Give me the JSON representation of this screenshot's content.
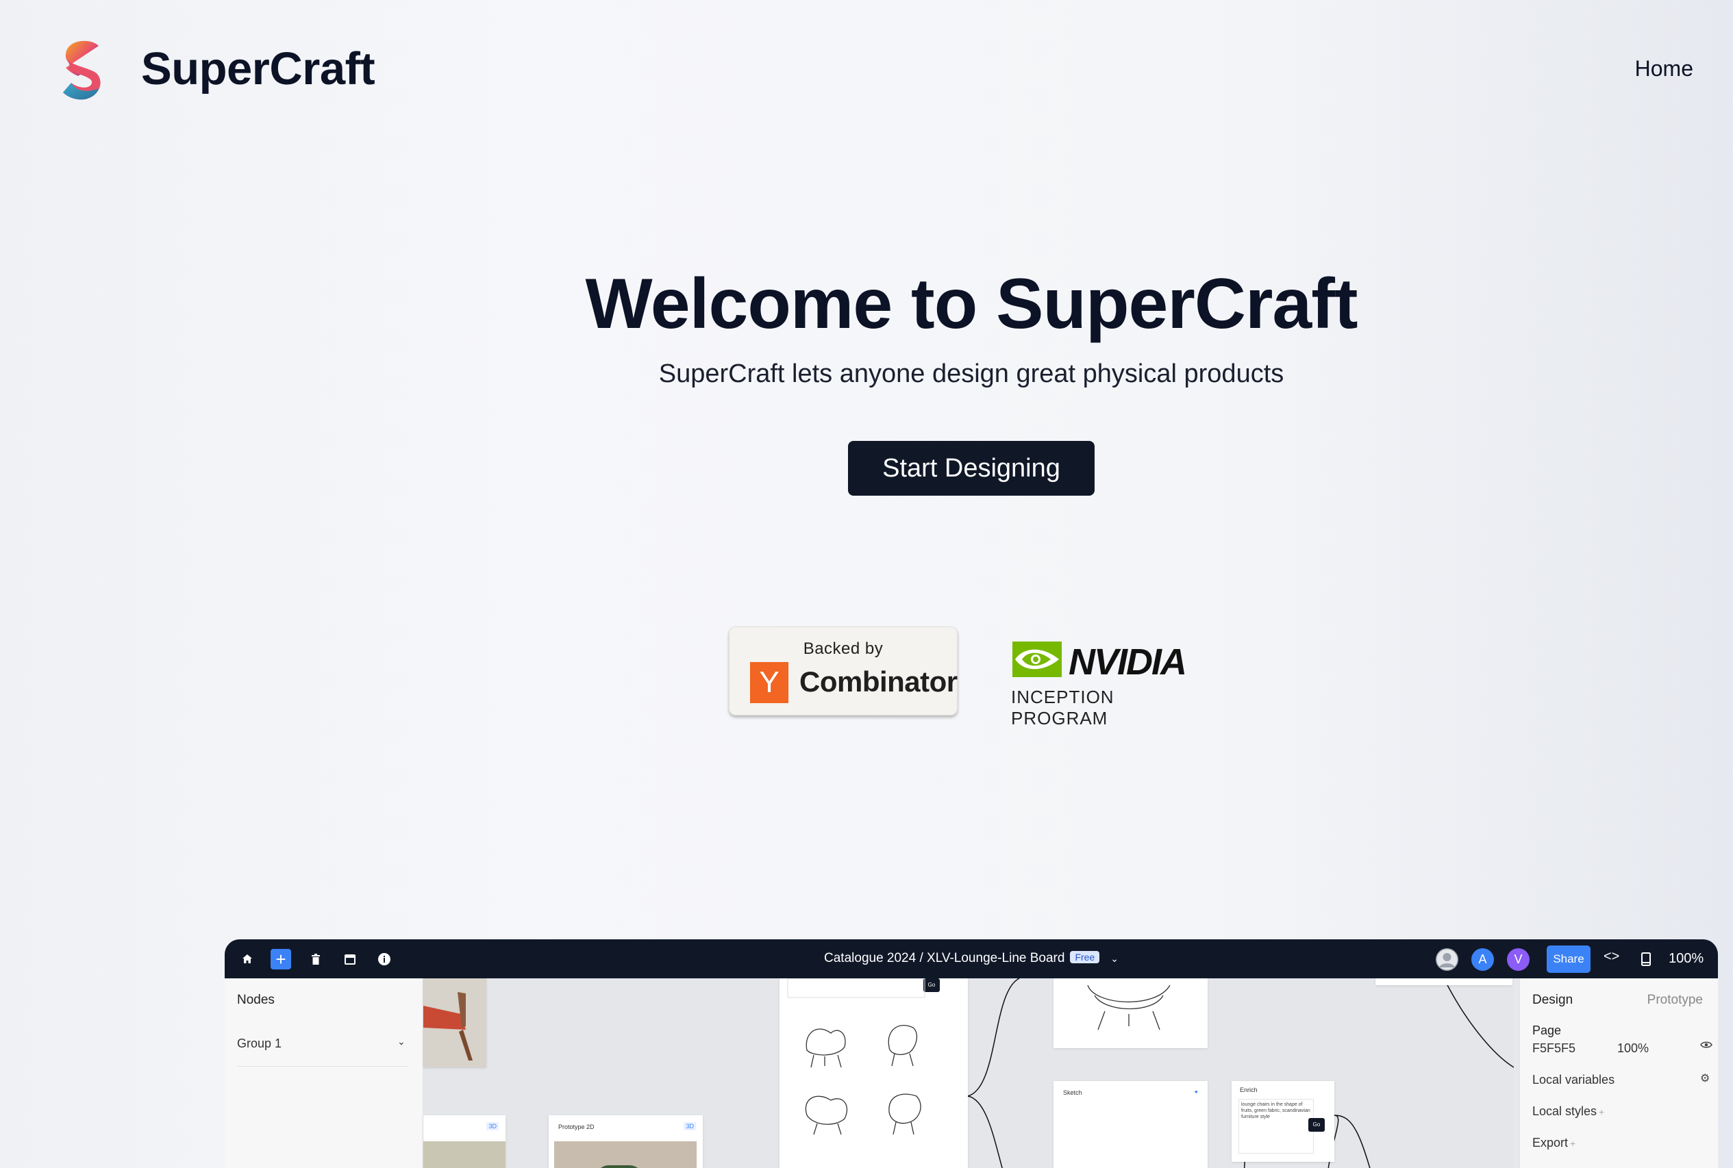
{
  "header": {
    "brand": "SuperCraft",
    "nav_home": "Home"
  },
  "hero": {
    "title": "Welcome to SuperCraft",
    "subtitle": "SuperCraft lets anyone design great physical products",
    "cta_label": "Start Designing"
  },
  "badges": {
    "yc": {
      "backed_by": "Backed by",
      "logo_letter": "Y",
      "name": "Combinator"
    },
    "nvidia": {
      "wordmark": "NVIDIA",
      "program": "INCEPTION PROGRAM"
    }
  },
  "app": {
    "topbar": {
      "title": "Catalogue 2024 / XLV-Lounge-Line Board",
      "plan_badge": "Free",
      "avatars": [
        {
          "letter": "",
          "color": "#9ca3af"
        },
        {
          "letter": "A",
          "color": "#3b82f6"
        },
        {
          "letter": "V",
          "color": "#8b5cf6"
        }
      ],
      "share_label": "Share",
      "zoom": "100%"
    },
    "left_panel": {
      "title": "Nodes",
      "group_label": "Group 1"
    },
    "canvas": {
      "cards": {
        "prototype_label": "Prototype 2D",
        "tag_3d": "3D",
        "sketch_label": "Sketch",
        "enrich_label": "Enrich",
        "enrich_text": "lounge chairs in the shape of fruits, green fabric, scandinavian furniture style",
        "go_label": "Go"
      }
    },
    "right_panel": {
      "tab_design": "Design",
      "tab_prototype": "Prototype",
      "page_label": "Page",
      "page_color": "F5F5F5",
      "page_opacity": "100%",
      "local_variables": "Local variables",
      "local_styles": "Local styles",
      "export": "Export"
    }
  },
  "colors": {
    "brand_dark": "#101828",
    "accent_blue": "#3b82f6",
    "yc_orange": "#f26522",
    "nvidia_green": "#76b900"
  }
}
